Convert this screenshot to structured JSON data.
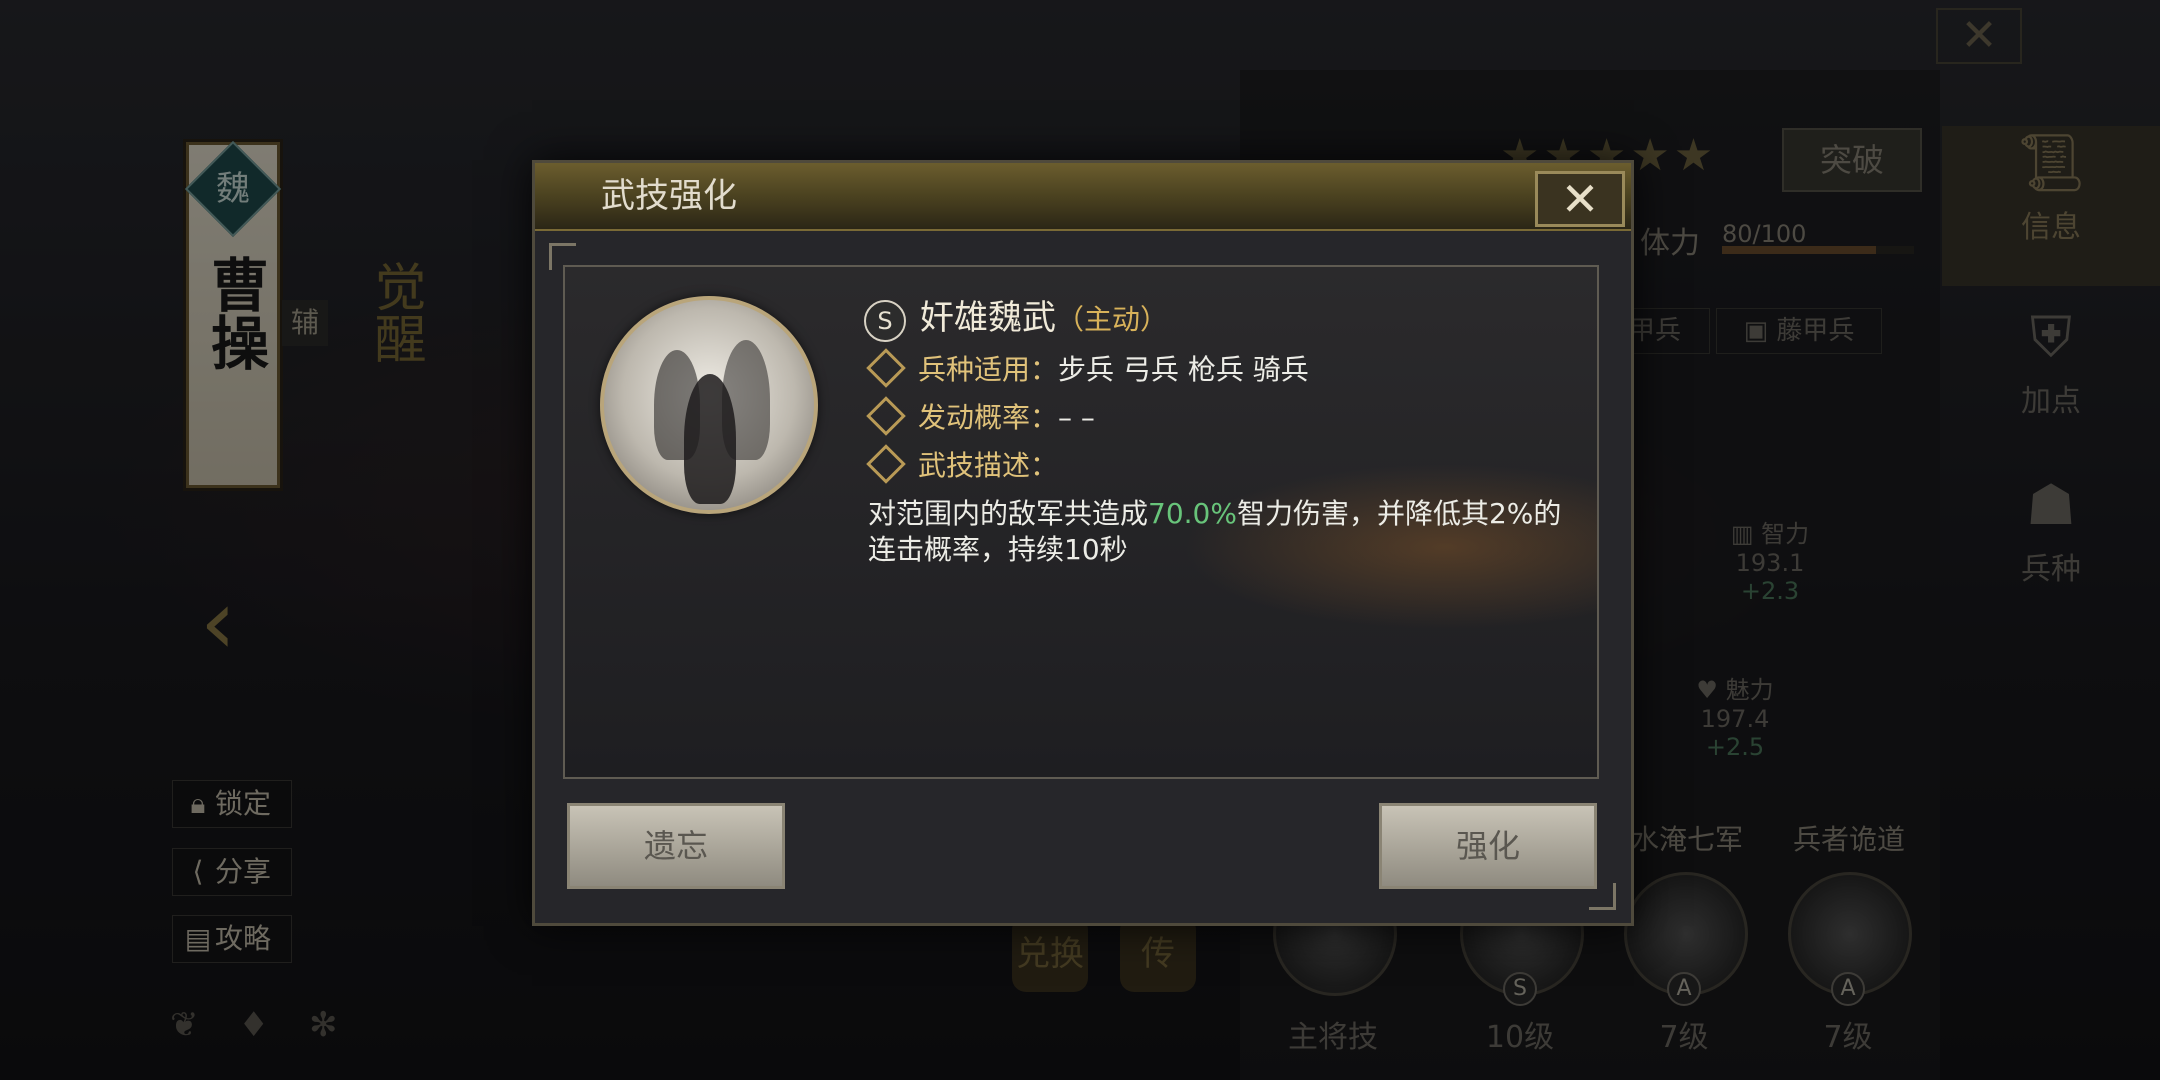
{
  "background": {
    "general": {
      "kingdom": "魏",
      "name": "曹操",
      "role_tag": "辅",
      "awaken_label": "觉醒"
    },
    "side_buttons": [
      {
        "icon": "lock-icon",
        "label": "锁定"
      },
      {
        "icon": "share-icon",
        "label": "分享"
      },
      {
        "icon": "guide-icon",
        "label": "攻略"
      }
    ],
    "center_buttons": [
      {
        "label": "兑换"
      },
      {
        "label": "传"
      }
    ],
    "right_panel": {
      "breakthrough_label": "突破",
      "stamina_label": "体力",
      "stamina_value": "80/100",
      "stamina_fraction": 0.8,
      "troop_tags": [
        "甲兵",
        "藤甲兵"
      ],
      "stats": [
        {
          "name": "智力",
          "value": "193.1",
          "bonus": "+2.3"
        },
        {
          "name": "魅力",
          "value": "197.4",
          "bonus": "+2.5"
        }
      ],
      "skills": [
        {
          "name": "",
          "grade": "",
          "level": "主将技"
        },
        {
          "name": "",
          "grade": "S",
          "level": "10级"
        },
        {
          "name": "水淹七军",
          "grade": "A",
          "level": "7级"
        },
        {
          "name": "兵者诡道",
          "grade": "A",
          "level": "7级"
        }
      ],
      "tabs": [
        {
          "label": "信息",
          "icon": "scroll-icon",
          "active": true
        },
        {
          "label": "加点",
          "icon": "armor-plus-icon",
          "active": false
        },
        {
          "label": "兵种",
          "icon": "helmet-icon",
          "active": false
        }
      ]
    }
  },
  "modal": {
    "title": "武技强化",
    "skill": {
      "grade": "S",
      "name": "奸雄魏武",
      "type": "（主动）",
      "troop_label": "兵种适用：",
      "troop_value": "步兵 弓兵 枪兵 骑兵",
      "chance_label": "发动概率：",
      "chance_value": "– –",
      "desc_label": "武技描述：",
      "desc_pre": "对范围内的敌军共造成",
      "desc_highlight": "70.0%",
      "desc_post": "智力伤害，并降低其2%的连击概率，持续10秒"
    },
    "buttons": {
      "forget": "遗忘",
      "enhance": "强化"
    }
  },
  "colors": {
    "accent_gold": "#e0c27a",
    "highlight_green": "#68c47a",
    "title_bar": "#5a4e25"
  }
}
